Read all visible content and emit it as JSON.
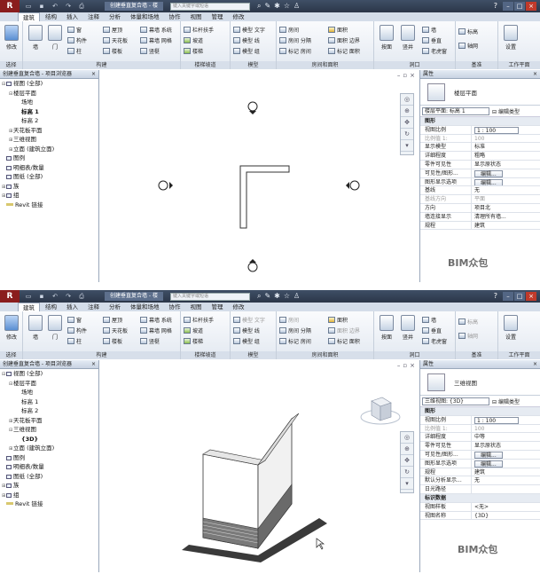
{
  "titlebar": {
    "logo": "R",
    "doc_title": "创建垂直复合墙 - 楼",
    "search_placeholder": "键入关键字或短语",
    "user_icon": "user-icon"
  },
  "tabs": [
    "建筑",
    "结构",
    "插入",
    "注释",
    "分析",
    "体量和场地",
    "协作",
    "视图",
    "管理",
    "修改"
  ],
  "ribbon": {
    "select": {
      "label": "选择",
      "modify": "修改"
    },
    "build": {
      "label": "构建",
      "wall": "墙",
      "door": "门",
      "window": "窗",
      "component": "构件",
      "column": "柱",
      "roof": "屋顶",
      "ceiling": "天花板",
      "floor": "楼板",
      "curtain_system": "幕墙 系统",
      "curtain_grid": "幕墙 网格",
      "mullion": "竖梃"
    },
    "circulation": {
      "label": "楼梯坡道",
      "railing": "栏杆扶手",
      "ramp": "坡道",
      "stair": "楼梯"
    },
    "model": {
      "label": "模型",
      "model_text": "模型 文字",
      "model_line": "模型 线",
      "model_group": "模型 组"
    },
    "room": {
      "label": "房间和面积",
      "room": "房间",
      "room_sep": "房间 分隔",
      "tag_room": "标记 房间",
      "area": "面积",
      "area_boundary": "面积 边界",
      "tag_area": "标记 面积"
    },
    "opening": {
      "label": "洞口",
      "by_face": "按面",
      "shaft": "竖井",
      "wall": "墙",
      "vertical": "垂直",
      "dormer": "老虎窗"
    },
    "datum": {
      "label": "基准",
      "level": "标高",
      "grid": "轴网"
    },
    "workplane": {
      "label": "工作平面",
      "set": "设置"
    }
  },
  "browser": {
    "title": "创建垂直复合墙 - 项目浏览器",
    "items_top": [
      "视图 (全部)",
      "楼层平面",
      "场地",
      "标高 1",
      "标高 2",
      "天花板平面",
      "三维视图",
      "立面 (建筑立面)",
      "图例",
      "明细表/数量",
      "图纸 (全部)",
      "族",
      "组",
      "Revit 链接"
    ],
    "items_bottom": [
      "视图 (全部)",
      "楼层平面",
      "场地",
      "标高 1",
      "标高 2",
      "天花板平面",
      "三维视图",
      "{3D}",
      "立面 (建筑立面)",
      "图例",
      "明细表/数量",
      "图纸 (全部)",
      "族",
      "组",
      "Revit 链接"
    ]
  },
  "props_top": {
    "title": "属性",
    "type_name": "楼层平面",
    "selector": "楼层平面: 标高 1",
    "edit_type": "编辑类型",
    "rows": [
      [
        "图形",
        ""
      ],
      [
        "视图比例",
        "1 : 100"
      ],
      [
        "比例值 1:",
        "100"
      ],
      [
        "显示模型",
        "标准"
      ],
      [
        "详细程度",
        "粗略"
      ],
      [
        "零件可见性",
        "显示原状态"
      ],
      [
        "可见性/图形...",
        "编辑..."
      ],
      [
        "图形显示选项",
        "编辑..."
      ],
      [
        "基线",
        "无"
      ],
      [
        "基线方向",
        "平面"
      ],
      [
        "方向",
        "项目北"
      ],
      [
        "墙连接显示",
        "清理所有墙..."
      ],
      [
        "规程",
        "建筑"
      ]
    ]
  },
  "props_bottom": {
    "title": "属性",
    "type_name": "三维视图",
    "selector": "三维视图: {3D}",
    "edit_type": "编辑类型",
    "rows": [
      [
        "图形",
        ""
      ],
      [
        "视图比例",
        "1 : 100"
      ],
      [
        "比例值 1:",
        "100"
      ],
      [
        "详细程度",
        "中等"
      ],
      [
        "零件可见性",
        "显示原状态"
      ],
      [
        "可见性/图形...",
        "编辑..."
      ],
      [
        "图形显示选项",
        "编辑..."
      ],
      [
        "规程",
        "建筑"
      ],
      [
        "默认分析显示...",
        "无"
      ],
      [
        "日光路径",
        ""
      ],
      [
        "标识数据",
        ""
      ],
      [
        "视图样板",
        "<无>"
      ],
      [
        "视图名称",
        "{3D}"
      ]
    ]
  },
  "watermark": "BIM众包"
}
